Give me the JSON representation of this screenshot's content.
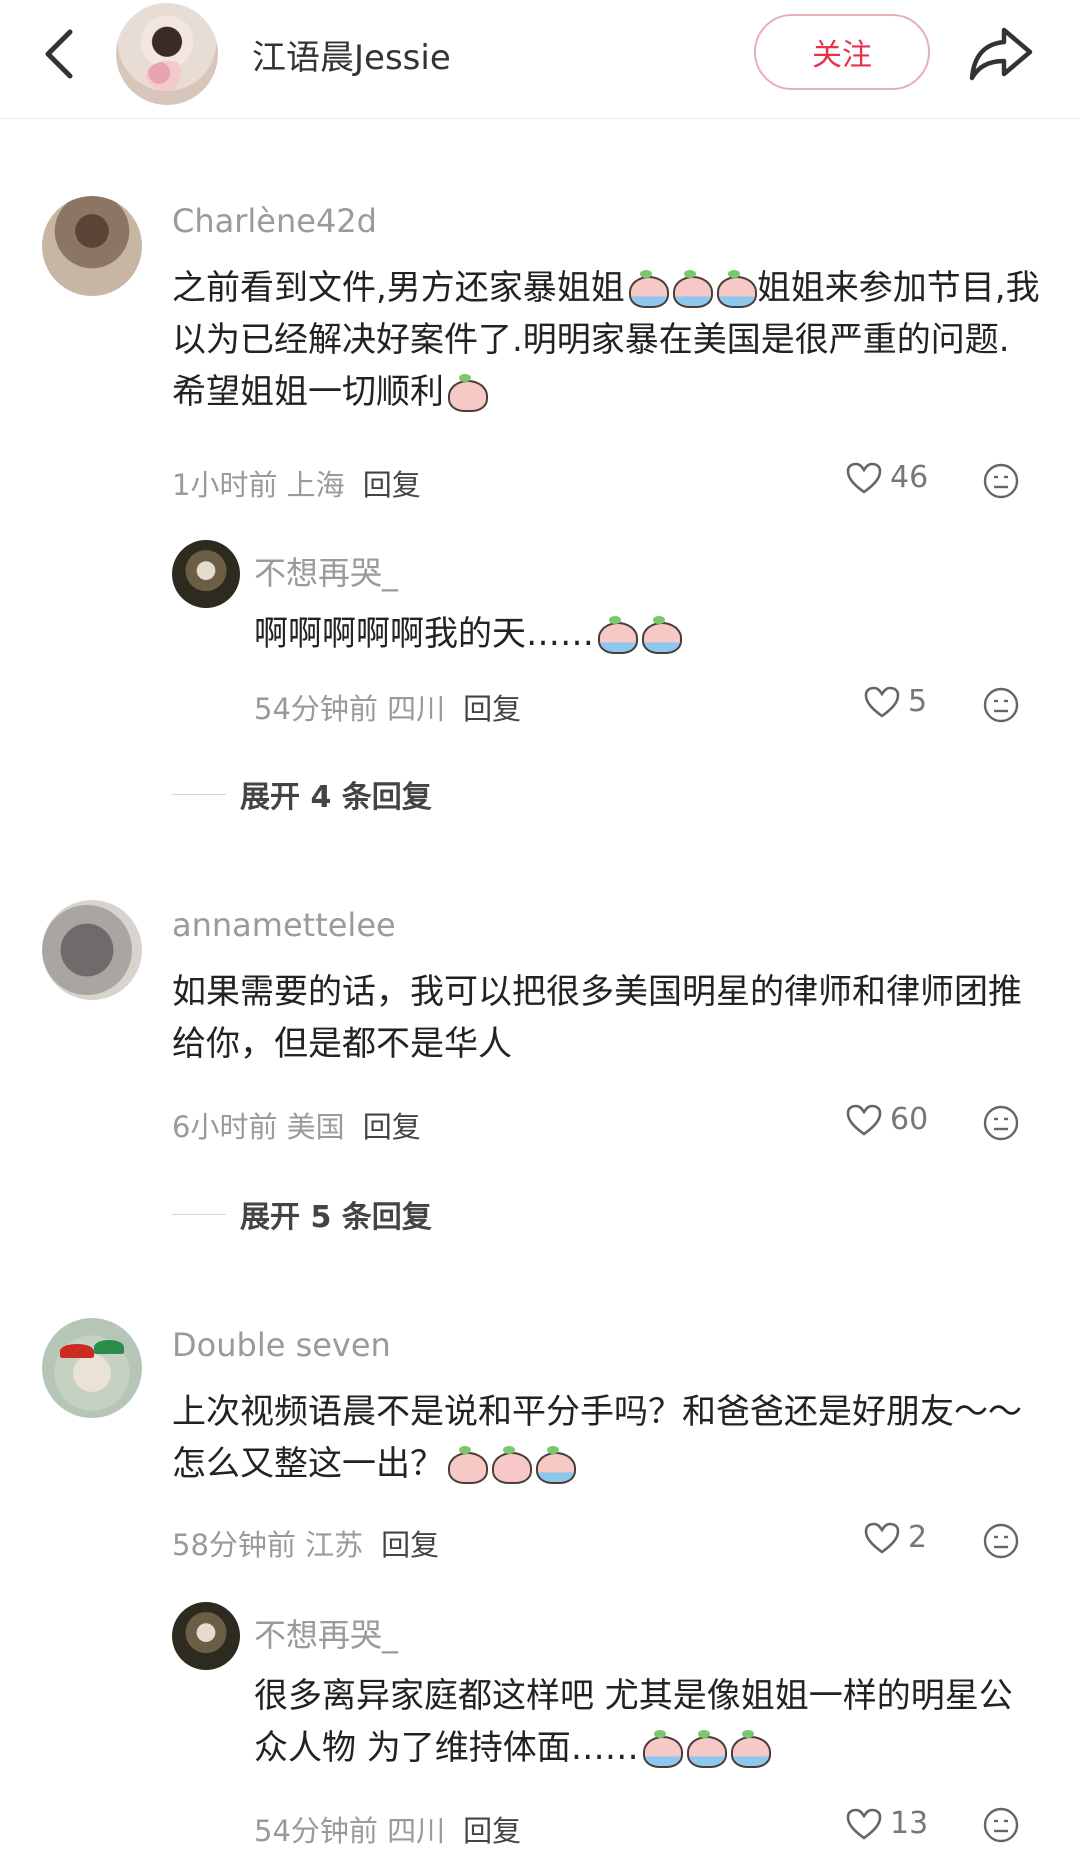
{
  "header": {
    "title": "江语晨Jessie",
    "follow_label": "关注"
  },
  "comments": [
    {
      "user": "Charlène42d",
      "text_a": "之前看到文件,男方还家暴姐姐",
      "text_b": "姐姐来参加节目,我以为已经解决好案件了.明明家暴在美国是很严重的问题.希望姐姐一切顺利",
      "time": "1小时前",
      "location": "上海",
      "reply_label": "回复",
      "likes": "46",
      "replies": [
        {
          "user": "不想再哭_",
          "text": "啊啊啊啊啊我的天……",
          "time": "54分钟前",
          "location": "四川",
          "reply_label": "回复",
          "likes": "5"
        }
      ],
      "expand_label": "展开 4 条回复"
    },
    {
      "user": "annamettelee",
      "text": "如果需要的话，我可以把很多美国明星的律师和律师团推给你，但是都不是华人",
      "time": "6小时前",
      "location": "美国",
      "reply_label": "回复",
      "likes": "60",
      "expand_label": "展开 5 条回复"
    },
    {
      "user": "Double seven",
      "text": "上次视频语晨不是说和平分手吗？和爸爸还是好朋友～～怎么又整这一出？",
      "time": "58分钟前",
      "location": "江苏",
      "reply_label": "回复",
      "likes": "2",
      "replies": [
        {
          "user": "不想再哭_",
          "text": "很多离异家庭都这样吧 尤其是像姐姐一样的明星公众人物 为了维持体面……",
          "time": "54分钟前",
          "location": "四川",
          "reply_label": "回复",
          "likes": "13"
        }
      ]
    }
  ],
  "icons": {
    "back": "chevron-left-icon",
    "share": "share-arrow-icon",
    "like": "heart-outline-icon",
    "dislike": "dislike-face-icon",
    "emoji": "crying-peach-emoji"
  },
  "colors": {
    "accent": "#e5334c",
    "meta": "#9a9a9a"
  }
}
